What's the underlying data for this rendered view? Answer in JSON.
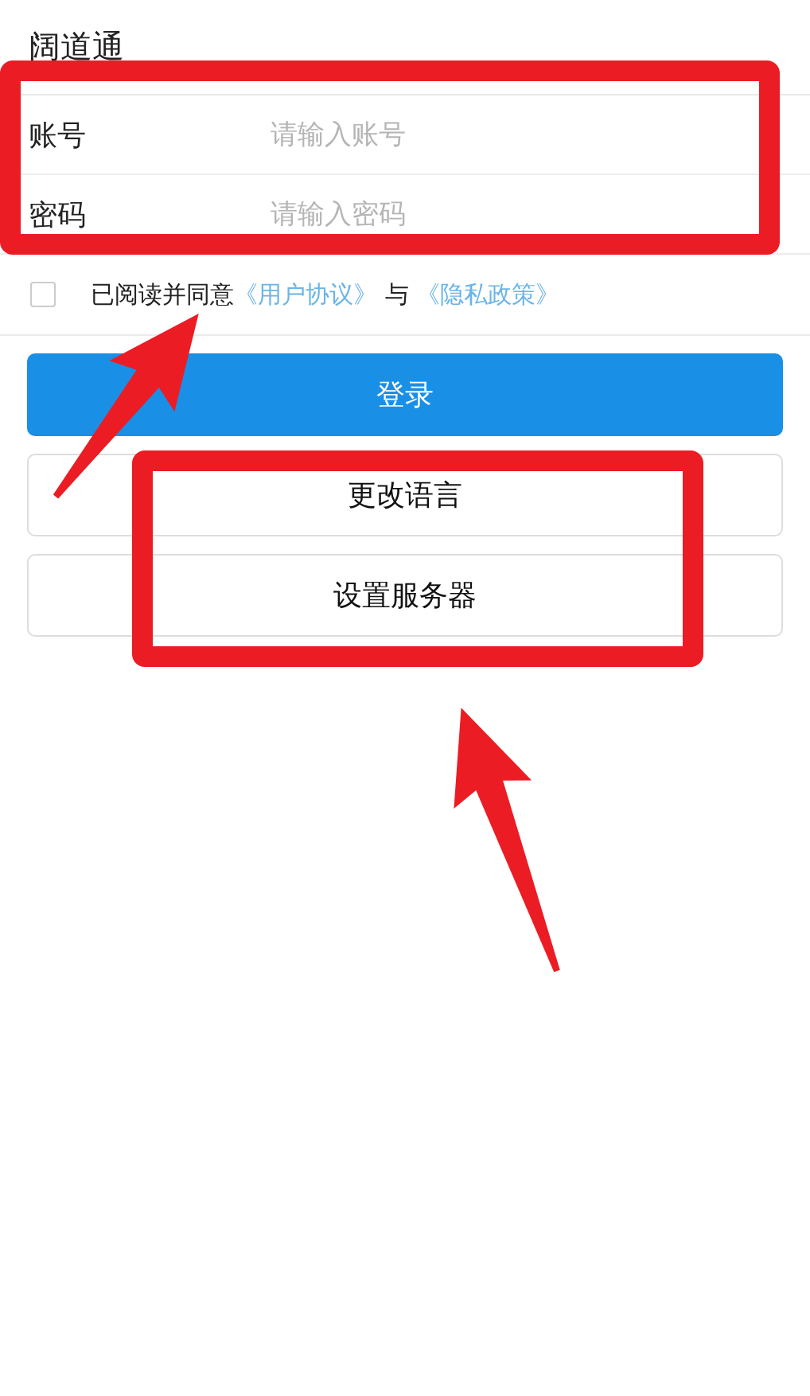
{
  "header": {
    "title": "阔道通"
  },
  "fields": [
    {
      "label": "账号",
      "placeholder": "请输入账号"
    },
    {
      "label": "密码",
      "placeholder": "请输入密码"
    }
  ],
  "agreement": {
    "checked": false,
    "text": "已阅读并同意",
    "links": [
      "《用户协议》",
      "《隐私政策》"
    ],
    "joiner": "与"
  },
  "buttons": [
    {
      "label": "登录",
      "kind": "primary"
    },
    {
      "label": "更改语言",
      "kind": "secondary"
    },
    {
      "label": "设置服务器",
      "kind": "secondary"
    }
  ]
}
